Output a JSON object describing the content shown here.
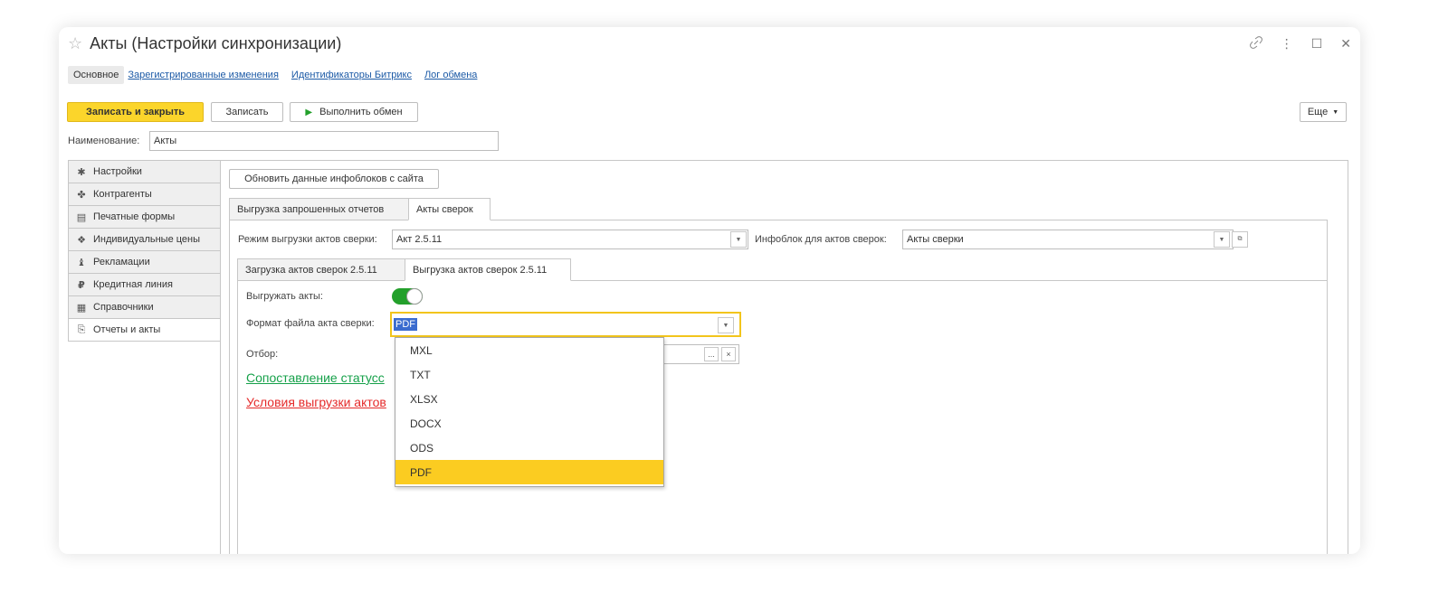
{
  "window": {
    "title": "Акты (Настройки синхронизации)",
    "controls": [
      "link-icon",
      "more-vertical-icon",
      "maximize-icon",
      "close-icon"
    ]
  },
  "navtabs": {
    "active": "Основное",
    "links": [
      "Зарегистрированные изменения",
      "Идентификаторы Битрикс",
      "Лог обмена"
    ]
  },
  "toolbar": {
    "save_close": "Записать и закрыть",
    "save": "Записать",
    "run_exchange": "Выполнить обмен",
    "more": "Еще"
  },
  "name_field": {
    "label": "Наименование:",
    "value": "Акты"
  },
  "sidebar": {
    "items": [
      {
        "label": "Настройки",
        "icon": "gear-icon"
      },
      {
        "label": "Контрагенты",
        "icon": "users-icon"
      },
      {
        "label": "Печатные формы",
        "icon": "document-icon"
      },
      {
        "label": "Индивидуальные цены",
        "icon": "handshake-icon"
      },
      {
        "label": "Рекламации",
        "icon": "complaint-icon"
      },
      {
        "label": "Кредитная линия",
        "icon": "ruble-icon"
      },
      {
        "label": "Справочники",
        "icon": "table-icon"
      },
      {
        "label": "Отчеты и акты",
        "icon": "clipboard-icon",
        "active": true
      }
    ]
  },
  "main": {
    "update_button": "Обновить данные инфоблоков с сайта",
    "tabs": [
      "Выгрузка запрошенных отчетов",
      "Акты сверок"
    ],
    "mode_label": "Режим выгрузки актов сверки:",
    "mode_value": "Акт 2.5.11",
    "infoblock_label": "Инфоблок для актов сверок:",
    "infoblock_value": "Акты сверки",
    "subtabs": [
      "Загрузка актов сверок 2.5.11",
      "Выгрузка актов сверок 2.5.11"
    ],
    "export_label": "Выгружать акты:",
    "format_label": "Формат файла акта сверки:",
    "format_value": "PDF",
    "filter_label": "Отбор:",
    "filter_more": "...",
    "filter_clear": "×",
    "link_status": "Сопоставление статусс",
    "link_conditions": "Условия выгрузки актов"
  },
  "dropdown": {
    "options": [
      "MXL",
      "TXT",
      "XLSX",
      "DOCX",
      "ODS",
      "PDF"
    ],
    "selected": "PDF"
  },
  "colors": {
    "primary_button": "#fbd52b",
    "toggle_on": "#23a02b",
    "link_blue": "#1c5aa6",
    "link_green": "#16a14a",
    "link_red": "#e52a2a",
    "selection": "#3b6ccf",
    "dropdown_selected": "#fbcc21"
  }
}
